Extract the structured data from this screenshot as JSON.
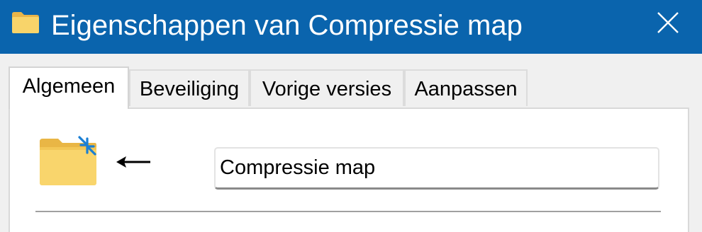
{
  "window": {
    "title": "Eigenschappen van Compressie map",
    "title_icon": "folder-icon",
    "close_icon": "close-icon",
    "colors": {
      "titlebar": "#0a64ad",
      "folder": "#f8d46a",
      "compress_arrows": "#1a7fd4"
    }
  },
  "tabs": [
    {
      "label": "Algemeen",
      "active": true
    },
    {
      "label": "Beveiliging",
      "active": false
    },
    {
      "label": "Vorige versies",
      "active": false
    },
    {
      "label": "Aanpassen",
      "active": false
    }
  ],
  "general": {
    "folder_icon": "compressed-folder-icon",
    "pointer_icon": "left-arrow-icon",
    "name_value": "Compressie map"
  }
}
